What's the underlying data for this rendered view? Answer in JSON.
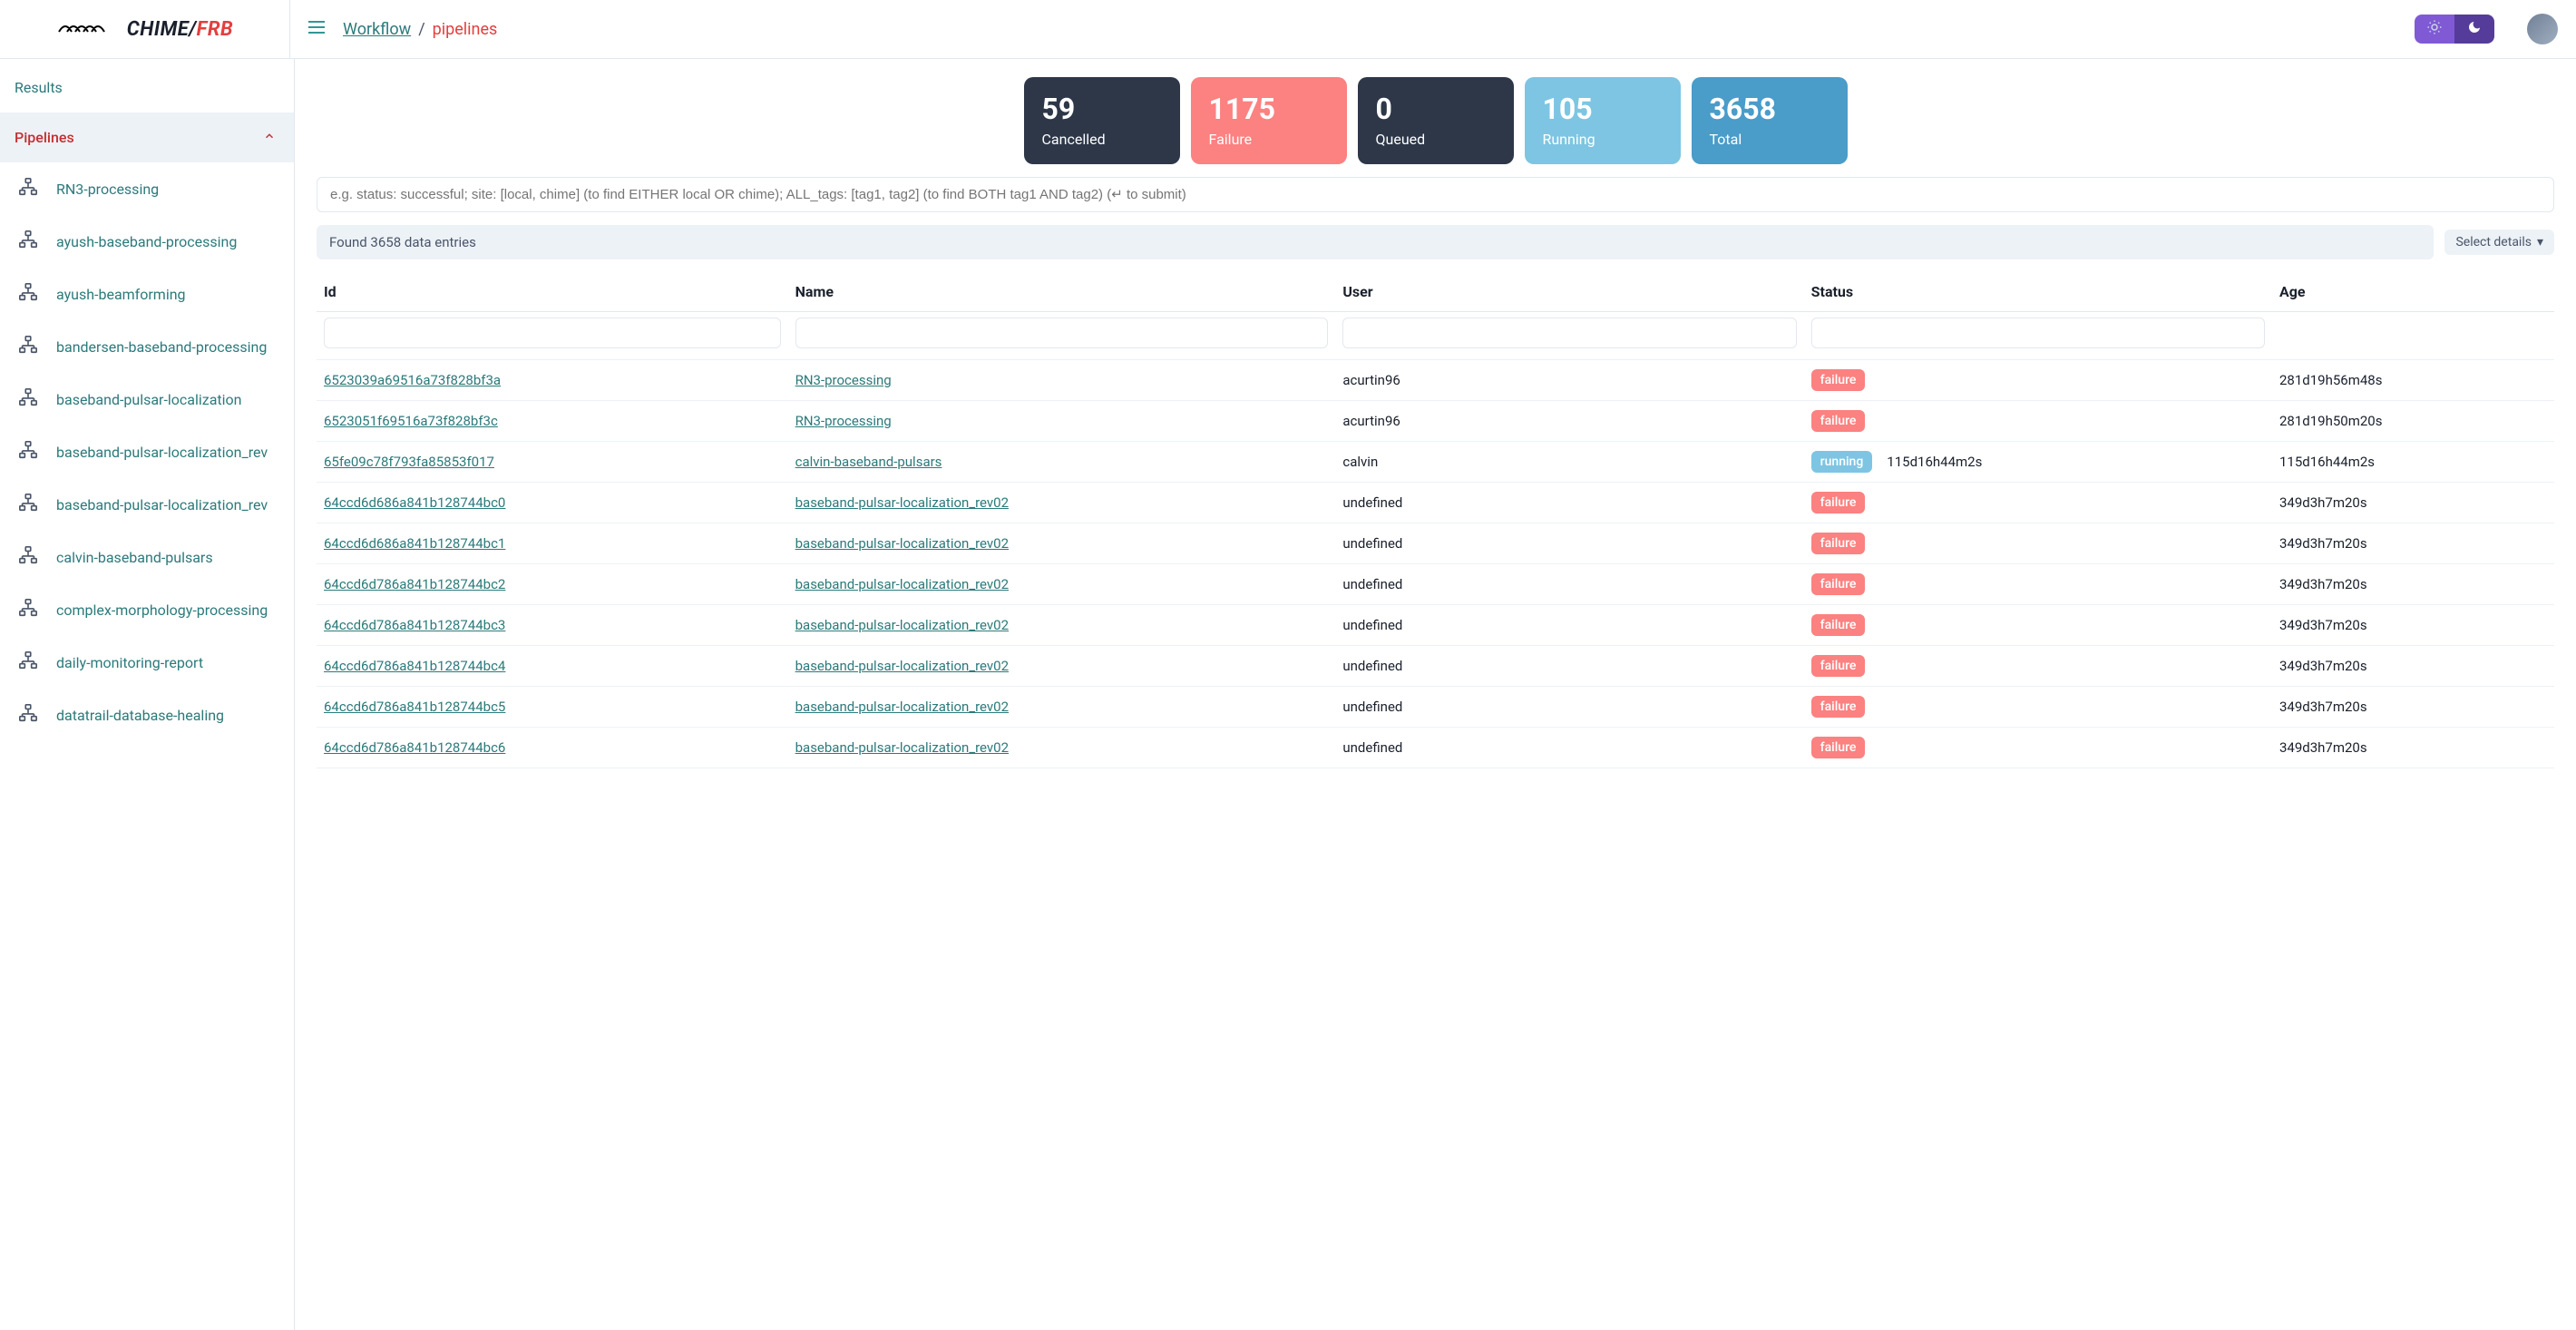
{
  "header": {
    "logo_chime": "CHIME/",
    "logo_frb": "FRB",
    "breadcrumb_root": "Workflow",
    "breadcrumb_sep": "/",
    "breadcrumb_current": "pipelines"
  },
  "sidebar": {
    "items": [
      {
        "label": "Results",
        "type": "link"
      },
      {
        "label": "Pipelines",
        "type": "active"
      }
    ],
    "sub_items": [
      {
        "label": "RN3-processing"
      },
      {
        "label": "ayush-baseband-processing"
      },
      {
        "label": "ayush-beamforming"
      },
      {
        "label": "bandersen-baseband-processing"
      },
      {
        "label": "baseband-pulsar-localization"
      },
      {
        "label": "baseband-pulsar-localization_rev"
      },
      {
        "label": "baseband-pulsar-localization_rev"
      },
      {
        "label": "calvin-baseband-pulsars"
      },
      {
        "label": "complex-morphology-processing"
      },
      {
        "label": "daily-monitoring-report"
      },
      {
        "label": "datatrail-database-healing"
      }
    ]
  },
  "stats": {
    "cancelled": {
      "value": "59",
      "label": "Cancelled"
    },
    "failure": {
      "value": "1175",
      "label": "Failure"
    },
    "queued": {
      "value": "0",
      "label": "Queued"
    },
    "running": {
      "value": "105",
      "label": "Running"
    },
    "total": {
      "value": "3658",
      "label": "Total"
    }
  },
  "search": {
    "placeholder": "e.g. status: successful; site: [local, chime] (to find EITHER local OR chime); ALL_tags: [tag1, tag2] (to find BOTH tag1 AND tag2) (↵ to submit)"
  },
  "results": {
    "count_text": "Found 3658 data entries",
    "details_label": "Select details"
  },
  "table": {
    "columns": [
      "Id",
      "Name",
      "User",
      "Status",
      "Age"
    ],
    "rows": [
      {
        "id": "6523039a69516a73f828bf3a",
        "name": "RN3-processing",
        "user": "acurtin96",
        "status": "failure",
        "status_extra": "",
        "age": "281d19h56m48s"
      },
      {
        "id": "6523051f69516a73f828bf3c",
        "name": "RN3-processing",
        "user": "acurtin96",
        "status": "failure",
        "status_extra": "",
        "age": "281d19h50m20s"
      },
      {
        "id": "65fe09c78f793fa85853f017",
        "name": "calvin-baseband-pulsars",
        "user": "calvin",
        "status": "running",
        "status_extra": "115d16h44m2s",
        "age": "115d16h44m2s"
      },
      {
        "id": "64ccd6d686a841b128744bc0",
        "name": "baseband-pulsar-localization_rev02",
        "user": "undefined",
        "status": "failure",
        "status_extra": "",
        "age": "349d3h7m20s"
      },
      {
        "id": "64ccd6d686a841b128744bc1",
        "name": "baseband-pulsar-localization_rev02",
        "user": "undefined",
        "status": "failure",
        "status_extra": "",
        "age": "349d3h7m20s"
      },
      {
        "id": "64ccd6d786a841b128744bc2",
        "name": "baseband-pulsar-localization_rev02",
        "user": "undefined",
        "status": "failure",
        "status_extra": "",
        "age": "349d3h7m20s"
      },
      {
        "id": "64ccd6d786a841b128744bc3",
        "name": "baseband-pulsar-localization_rev02",
        "user": "undefined",
        "status": "failure",
        "status_extra": "",
        "age": "349d3h7m20s"
      },
      {
        "id": "64ccd6d786a841b128744bc4",
        "name": "baseband-pulsar-localization_rev02",
        "user": "undefined",
        "status": "failure",
        "status_extra": "",
        "age": "349d3h7m20s"
      },
      {
        "id": "64ccd6d786a841b128744bc5",
        "name": "baseband-pulsar-localization_rev02",
        "user": "undefined",
        "status": "failure",
        "status_extra": "",
        "age": "349d3h7m20s"
      },
      {
        "id": "64ccd6d786a841b128744bc6",
        "name": "baseband-pulsar-localization_rev02",
        "user": "undefined",
        "status": "failure",
        "status_extra": "",
        "age": "349d3h7m20s"
      }
    ]
  }
}
